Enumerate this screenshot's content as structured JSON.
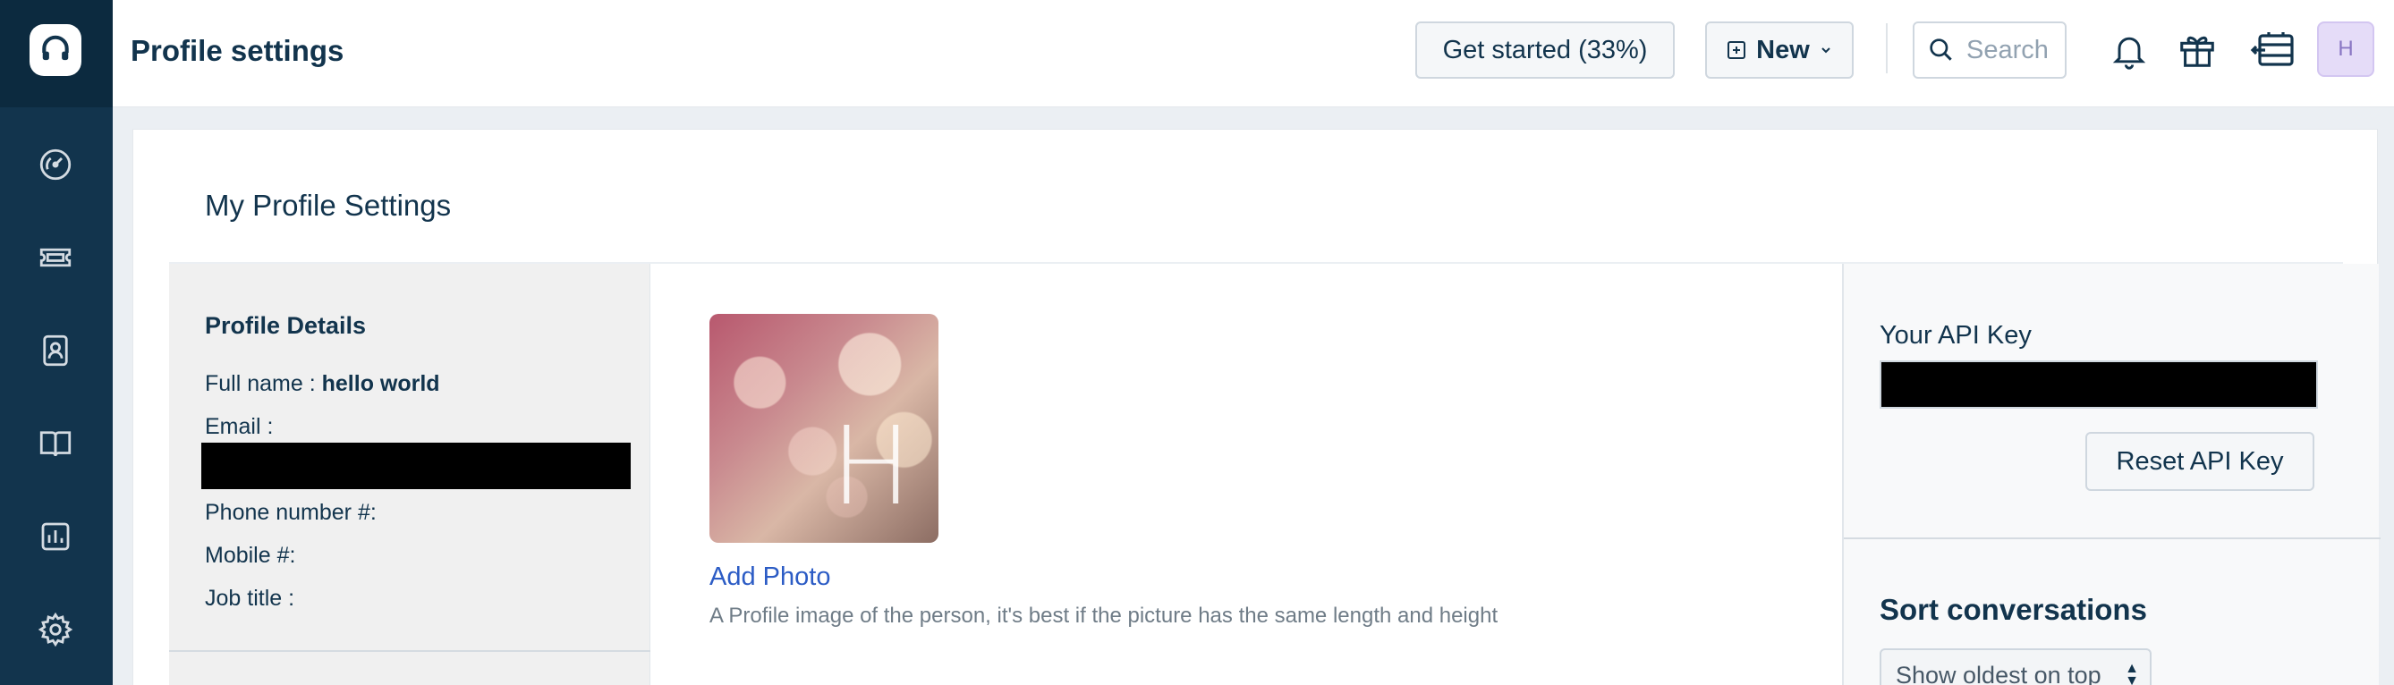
{
  "header": {
    "title": "Profile settings",
    "get_started_label": "Get started (33%)",
    "new_label": "New",
    "search_placeholder": "Search",
    "avatar_initial": "H"
  },
  "sidebar": {
    "items": [
      {
        "name": "dashboard",
        "icon": "dashboard-icon"
      },
      {
        "name": "tickets",
        "icon": "ticket-icon"
      },
      {
        "name": "contacts",
        "icon": "contacts-icon"
      },
      {
        "name": "solutions",
        "icon": "book-icon"
      },
      {
        "name": "reports",
        "icon": "chart-icon"
      },
      {
        "name": "admin",
        "icon": "gear-icon"
      }
    ]
  },
  "card": {
    "title": "My Profile Settings"
  },
  "profile": {
    "section_title": "Profile Details",
    "full_name_label": "Full name :",
    "full_name_value": "hello world",
    "email_label": "Email :",
    "phone_label": "Phone number #:",
    "mobile_label": "Mobile #:",
    "job_title_label": "Job title :"
  },
  "photo": {
    "initial": "H",
    "add_photo_label": "Add Photo",
    "help_text": "A Profile image of the person, it's best if the picture has the same length and height"
  },
  "api": {
    "label": "Your API Key",
    "reset_label": "Reset API Key"
  },
  "sort": {
    "title": "Sort conversations",
    "selected": "Show oldest on top"
  },
  "colors": {
    "sidebar_bg": "#12344d",
    "link": "#2c5cc5",
    "avatar_bg": "#e5dcf8"
  }
}
